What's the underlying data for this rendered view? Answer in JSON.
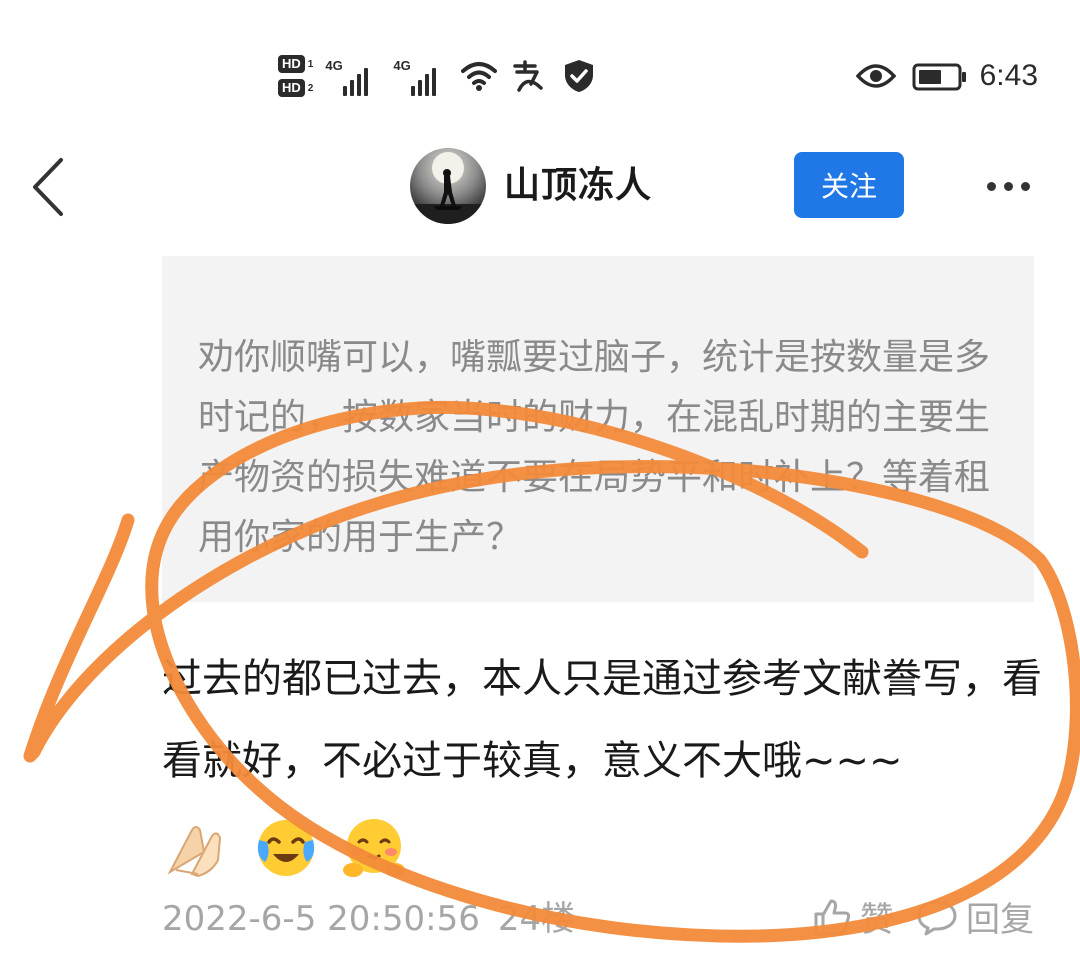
{
  "status_bar": {
    "hd1": "HD",
    "hd1_num": "1",
    "hd2": "HD",
    "hd2_num": "2",
    "sig1_label": "4G",
    "sig2_label": "4G",
    "alipay_icon": "alipay-icon",
    "time": "6:43"
  },
  "header": {
    "username": "山顶冻人",
    "follow_label": "关注"
  },
  "quote": {
    "text": "劝你顺嘴可以，嘴瓢要过脑子，统计是按数量是多时记的，按数家当时的财力，在混乱时期的主要生产物资的损失难道不要在局势平和时补上？等着租用你家的用于生产？"
  },
  "comment": {
    "text": "过去的都已过去，本人只是通过参考文献誊写，看看就好，不必过于较真，意义不大哦~~~",
    "emojis": [
      "pray-hands-emoji",
      "crying-laughing-emoji",
      "blushing-hug-emoji"
    ]
  },
  "meta": {
    "datetime": "2022-6-5 20:50:56",
    "floor": "24楼",
    "like_label": "赞",
    "reply_label": "回复"
  },
  "colors": {
    "accent": "#1f78e6",
    "annotation": "#f28a3a",
    "quote_bg": "#f3f3f3"
  }
}
